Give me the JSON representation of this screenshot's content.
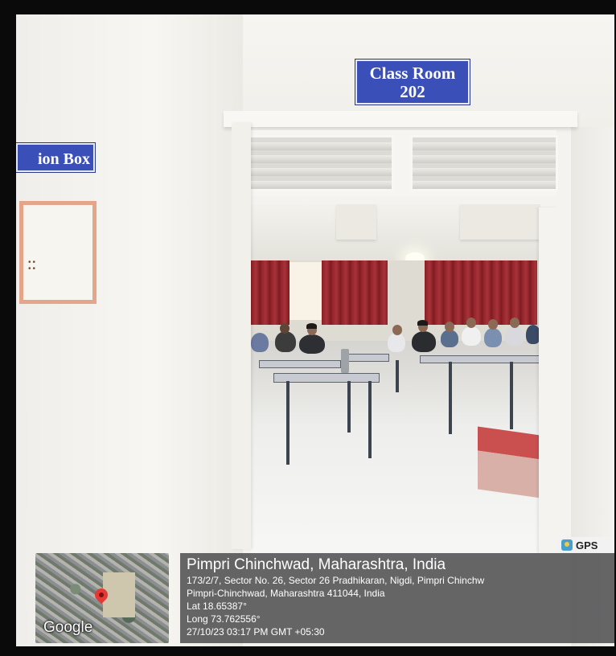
{
  "signs": {
    "classroom_line1": "Class Room",
    "classroom_line2": "202",
    "side_sign": "ion Box"
  },
  "gps_badge": {
    "label": "GPS",
    "icon": "camera-icon"
  },
  "map": {
    "logo": "Google",
    "pin_icon": "map-pin-icon"
  },
  "location": {
    "title": "Pimpri Chinchwad, Maharashtra, India",
    "address_line1": "173/2/7, Sector No. 26, Sector 26 Pradhikaran, Nigdi, Pimpri Chinchw",
    "address_line2": "Pimpri-Chinchwad, Maharashtra 411044, India",
    "lat": "Lat 18.65387°",
    "long": "Long 73.762556°",
    "timestamp": "27/10/23 03:17 PM GMT +05:30"
  },
  "colors": {
    "sign_blue": "#3a4fb8",
    "curtain_red": "#8a1f25",
    "overlay_gray": "#464648"
  }
}
